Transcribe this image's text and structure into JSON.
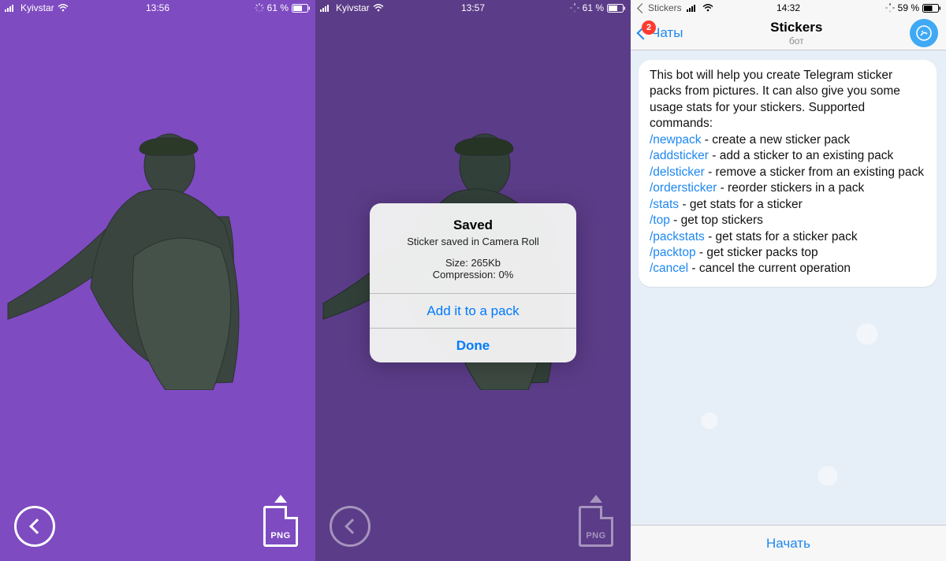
{
  "screen1": {
    "carrier": "Kyivstar",
    "time": "13:56",
    "battery": "61 %",
    "png_label": "PNG"
  },
  "screen2": {
    "carrier": "Kyivstar",
    "time": "13:57",
    "battery": "61 %",
    "png_label": "PNG",
    "alert": {
      "title": "Saved",
      "subtitle": "Sticker saved in Camera Roll",
      "size_line": "Size: 265Kb",
      "compression_line": "Compression: 0%",
      "add_button": "Add it to a pack",
      "done_button": "Done"
    }
  },
  "screen3": {
    "breadcrumb_app": "Stickers",
    "time": "14:32",
    "battery": "59 %",
    "back_label": "Чаты",
    "badge_count": "2",
    "title": "Stickers",
    "subtitle": "бот",
    "message_intro": "This bot will help you create Telegram sticker packs from pictures. It can also give you some usage stats for your stickers. Supported commands:",
    "commands": [
      {
        "cmd": "/newpack",
        "desc": " - create a new sticker pack"
      },
      {
        "cmd": "/addsticker",
        "desc": " - add a sticker to an existing pack"
      },
      {
        "cmd": "/delsticker",
        "desc": " - remove a sticker from an existing pack"
      },
      {
        "cmd": "/ordersticker",
        "desc": " - reorder stickers in a pack"
      },
      {
        "cmd": "/stats",
        "desc": " - get stats for a sticker"
      },
      {
        "cmd": "/top",
        "desc": " - get top stickers"
      },
      {
        "cmd": "/packstats",
        "desc": " - get stats for a sticker pack"
      },
      {
        "cmd": "/packtop",
        "desc": " - get sticker packs top"
      },
      {
        "cmd": "/cancel",
        "desc": " - cancel the current operation"
      }
    ],
    "start_button": "Начать"
  }
}
